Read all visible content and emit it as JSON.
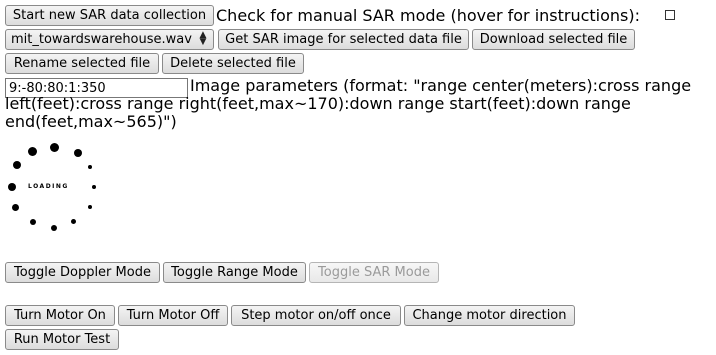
{
  "row1": {
    "start_button": "Start new SAR data collection",
    "manual_label": "Check for manual SAR mode (hover for instructions):",
    "manual_checked": false
  },
  "row2": {
    "file_select_value": "mit_towardswarehouse.wav",
    "get_image_button": "Get SAR image for selected data file",
    "download_button": "Download selected file"
  },
  "row3": {
    "rename_button": "Rename selected file",
    "delete_button": "Delete selected file"
  },
  "params": {
    "input_value": "9:-80:80:1:350",
    "description": "Image parameters (format: \"range center(meters):cross range left(feet):cross range right(feet,max~170):down range start(feet):down range end(feet,max~565)\")"
  },
  "spinner": {
    "text": "LOADING"
  },
  "modes": {
    "doppler_button": "Toggle Doppler Mode",
    "range_button": "Toggle Range Mode",
    "sar_button": "Toggle SAR Mode",
    "sar_disabled": true
  },
  "motor": {
    "on_button": "Turn Motor On",
    "off_button": "Turn Motor Off",
    "step_button": "Step motor on/off once",
    "direction_button": "Change motor direction",
    "test_button": "Run Motor Test"
  }
}
